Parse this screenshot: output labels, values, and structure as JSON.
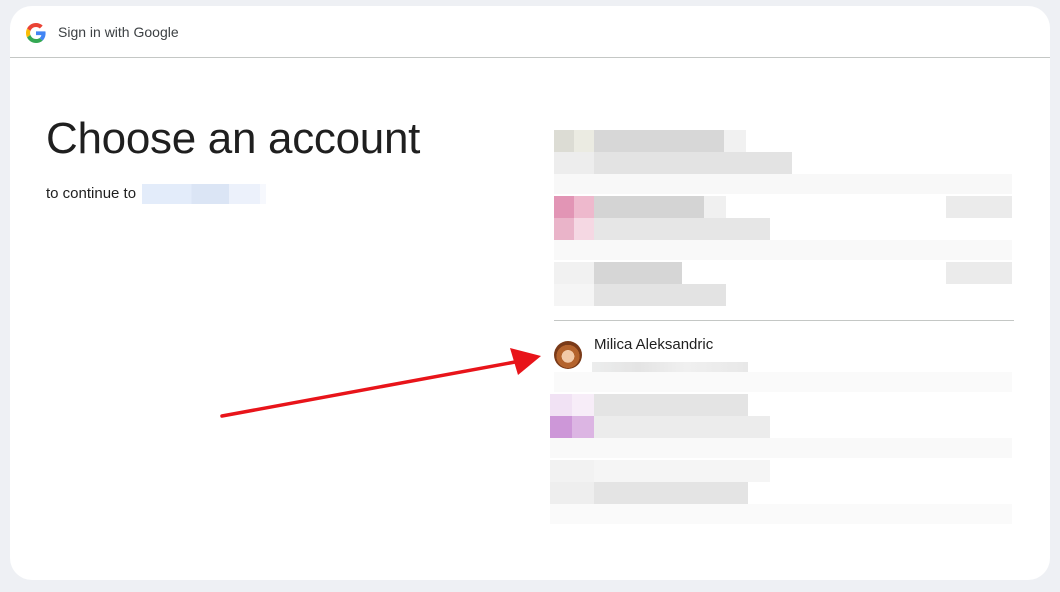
{
  "header": {
    "title": "Sign in with Google",
    "logo_icon": "google-g-icon"
  },
  "main": {
    "title": "Choose an account",
    "subtitle": "to continue to"
  },
  "accounts": [
    {
      "name": "Milica Aleksandric",
      "avatar_icon": "user-avatar"
    }
  ],
  "annotation": {
    "arrow_color": "#e8141a"
  }
}
